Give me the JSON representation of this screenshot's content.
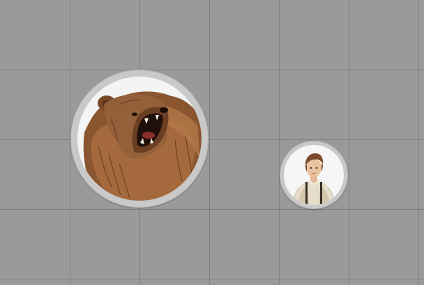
{
  "map": {
    "background_color": "#9a9a9a",
    "grid_color": "#7f7f7f",
    "grid_cell_count": {
      "columns": 6,
      "rows": 4
    }
  },
  "tokens": [
    {
      "id": "bear",
      "icon": "roaring-bear-portrait",
      "ring_color": "#c9c9c9"
    },
    {
      "id": "boy",
      "icon": "boy-with-suspenders-portrait",
      "ring_color": "#c9c9c9"
    }
  ]
}
